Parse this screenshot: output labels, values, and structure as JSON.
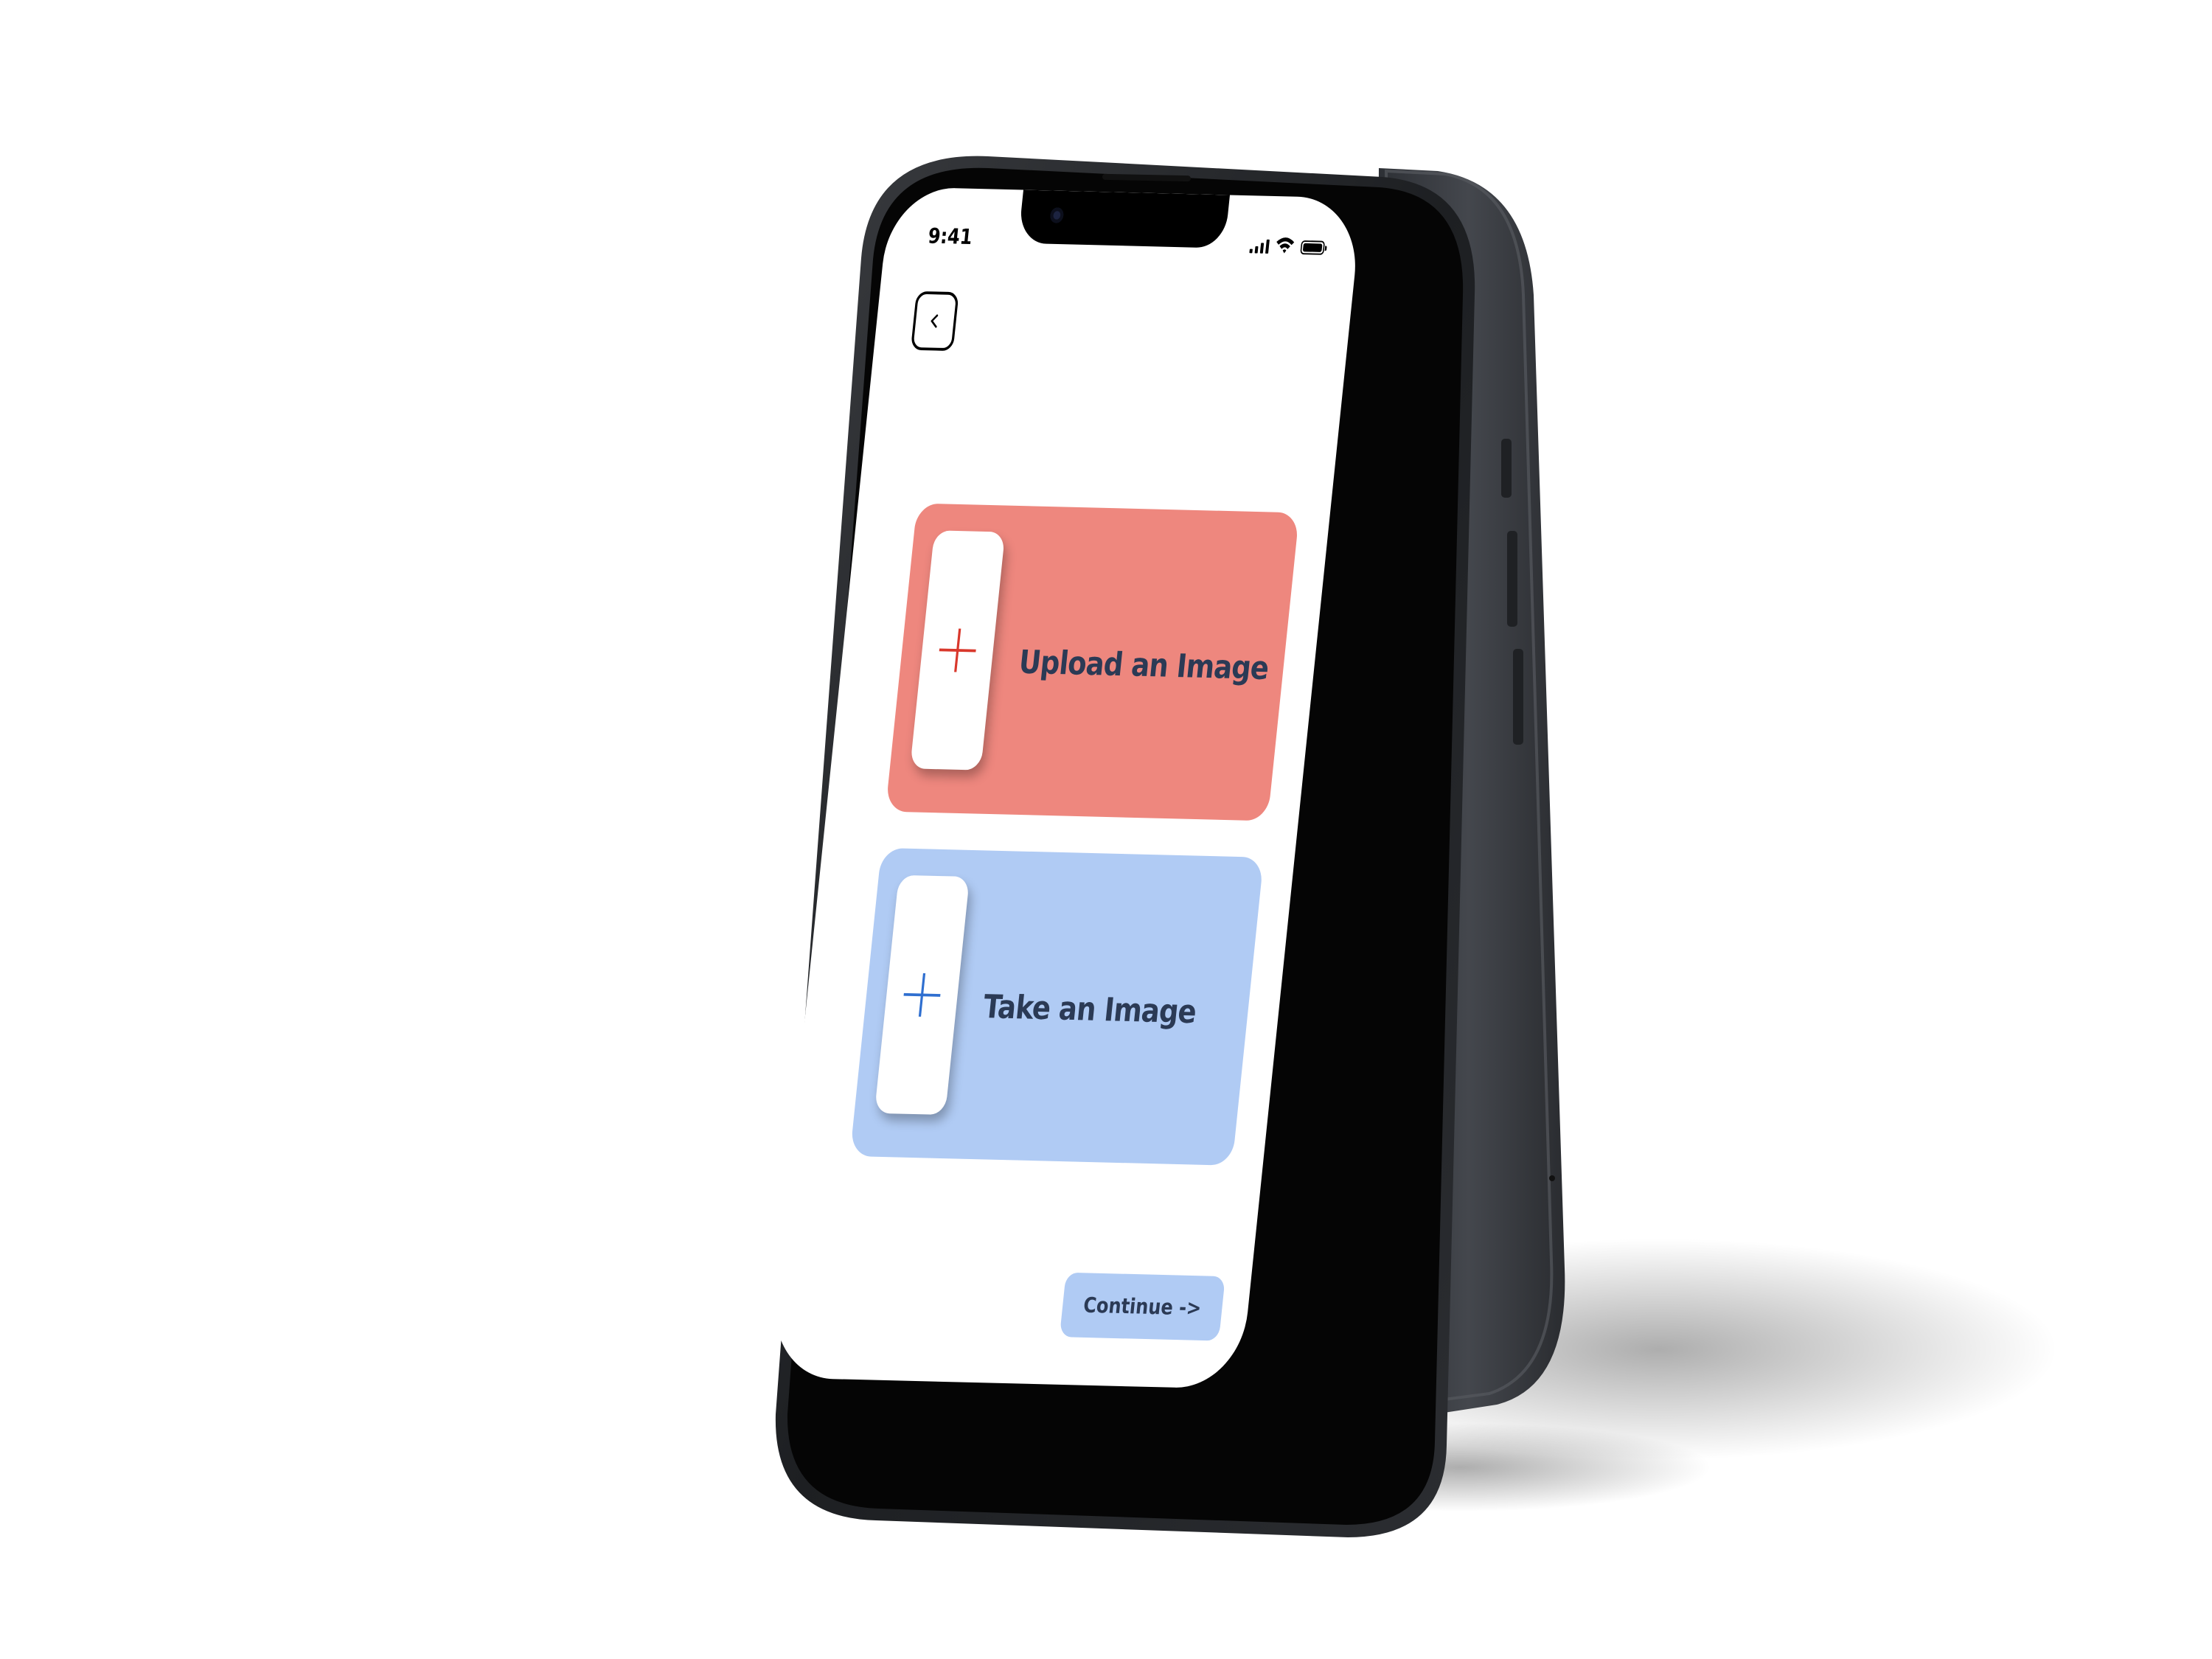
{
  "status_bar": {
    "time": "9:41",
    "icons": [
      "signal-icon",
      "wifi-icon",
      "battery-icon"
    ]
  },
  "back_button": {
    "icon": "chevron-left-icon"
  },
  "upload_card": {
    "label": "Upload an Image",
    "icon": "plus-icon",
    "background": "#ee877e",
    "icon_color": "#d9382c"
  },
  "take_card": {
    "label": "Take an Image",
    "icon": "plus-icon",
    "background": "#b0cbf4",
    "icon_color": "#2f6fd0"
  },
  "continue_button": {
    "label": "Continue ->",
    "background": "#b0cbf4"
  },
  "colors": {
    "text": "#2b3a55",
    "phone_frame": "#1f2124",
    "phone_back": "#3a3d42"
  }
}
